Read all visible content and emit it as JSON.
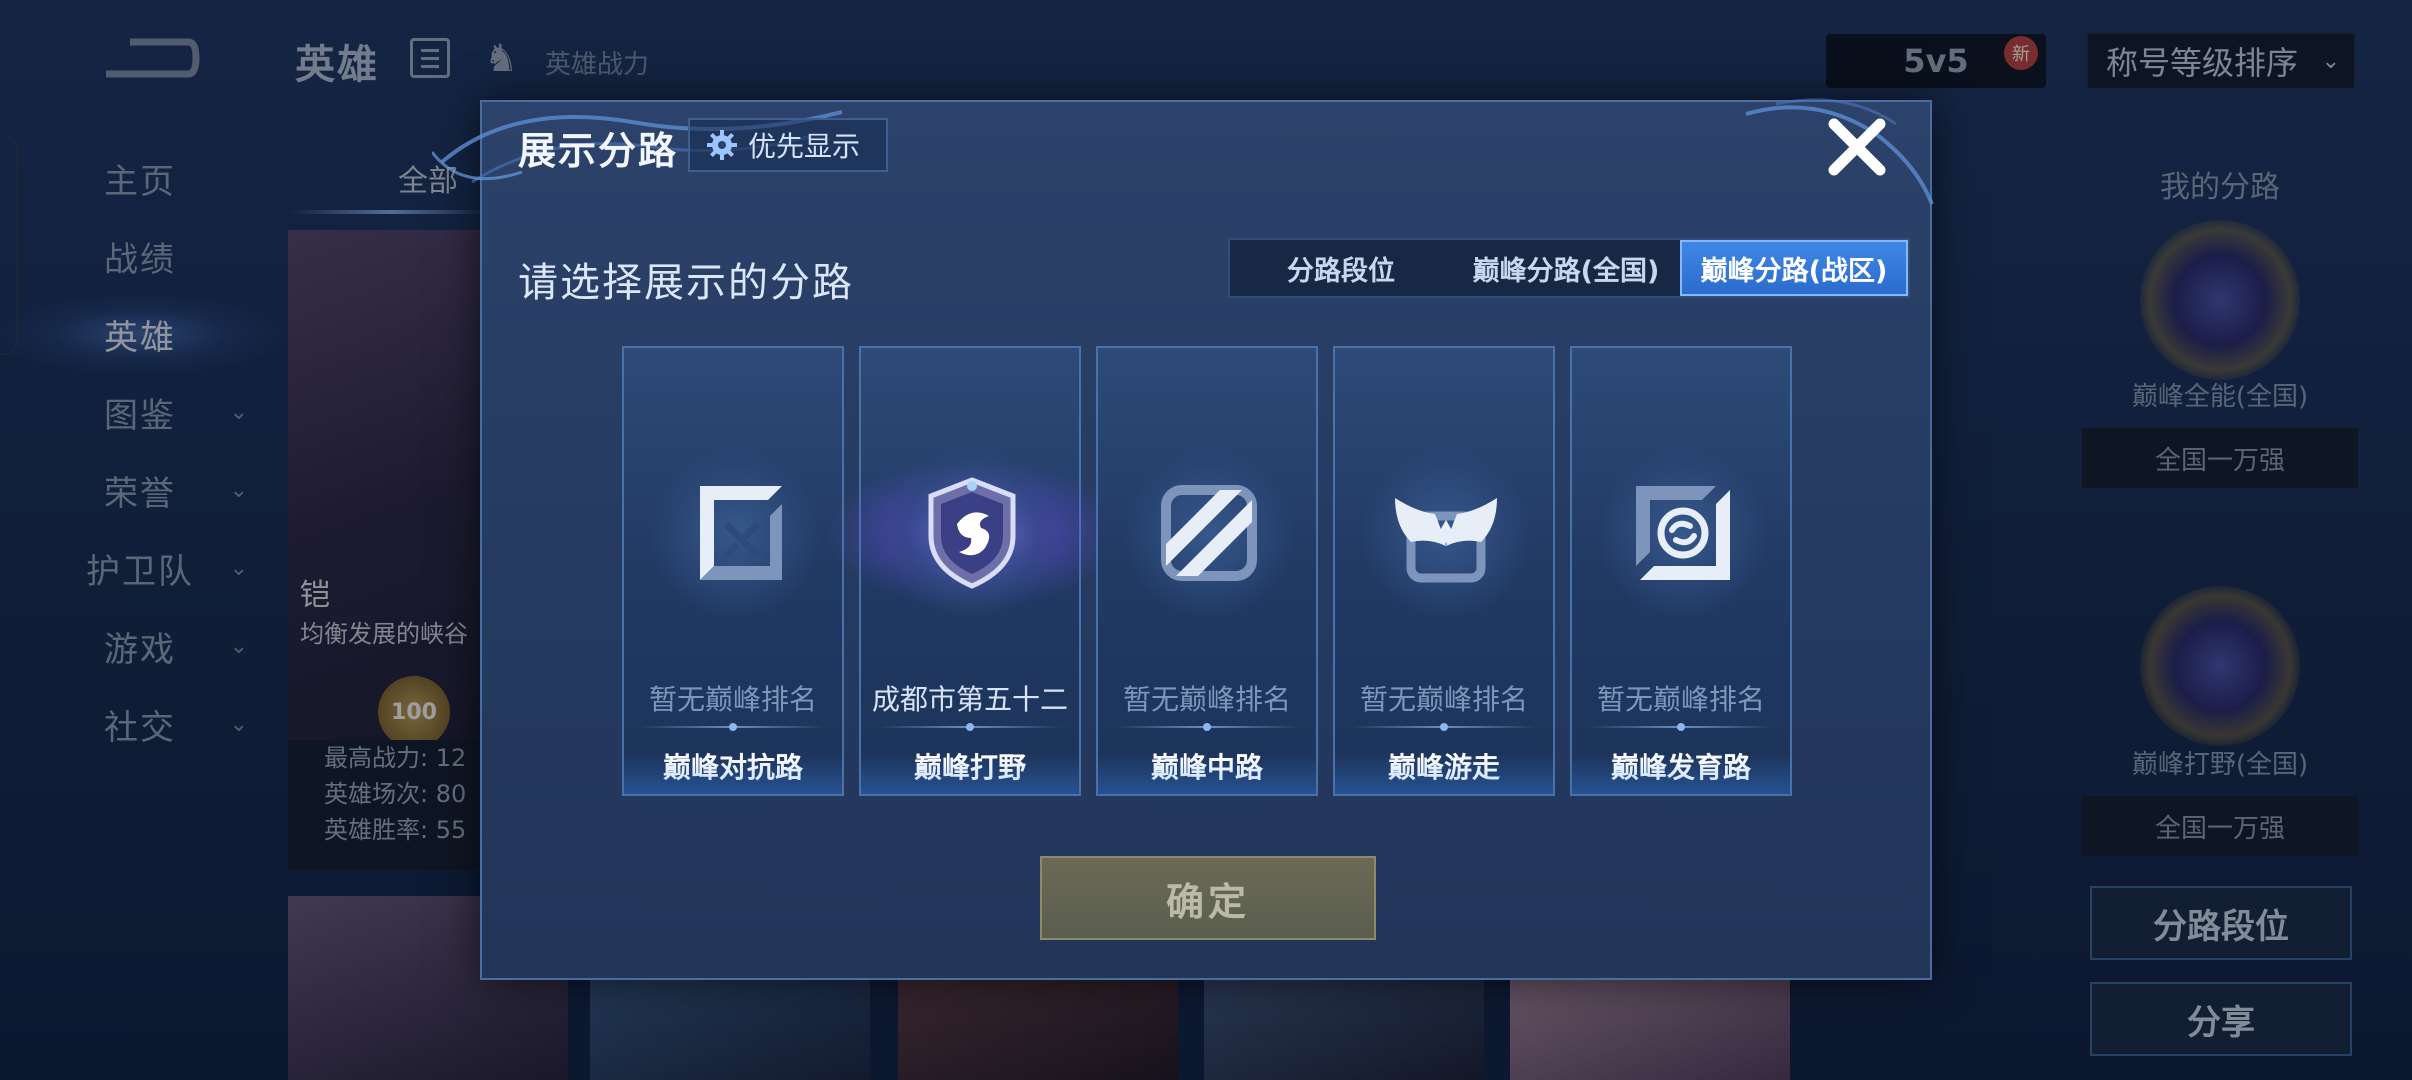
{
  "background": {
    "header": {
      "title": "英雄",
      "power_label": "英雄战力",
      "mode": "5v5",
      "new_badge": "新",
      "sort_label": "称号等级排序"
    },
    "sidebar": {
      "items": [
        {
          "label": "主页",
          "active": false,
          "expandable": false
        },
        {
          "label": "战绩",
          "active": false,
          "expandable": false
        },
        {
          "label": "英雄",
          "active": true,
          "expandable": false
        },
        {
          "label": "图鉴",
          "active": false,
          "expandable": true
        },
        {
          "label": "荣誉",
          "active": false,
          "expandable": true
        },
        {
          "label": "护卫队",
          "active": false,
          "expandable": true
        },
        {
          "label": "游戏",
          "active": false,
          "expandable": true
        },
        {
          "label": "社交",
          "active": false,
          "expandable": true
        }
      ]
    },
    "tabs": {
      "all": "全部"
    },
    "hero_card": {
      "name": "铠",
      "desc": "均衡发展的峡谷",
      "badge": "100",
      "stats": [
        "最高战力: 12",
        "英雄场次: 80",
        "英雄胜率: 55"
      ]
    },
    "right_panel": {
      "title": "我的分路",
      "lanes": [
        {
          "name": "巅峰全能(全国)",
          "rank": "全国一万强"
        },
        {
          "name": "巅峰打野(全国)",
          "rank": "全国一万强"
        }
      ],
      "lane_rank_button": "分路段位",
      "share_button": "分享"
    }
  },
  "modal": {
    "title": "展示分路",
    "priority_button": "优先显示",
    "subtitle": "请选择展示的分路",
    "segments": [
      {
        "label": "分路段位",
        "active": false
      },
      {
        "label": "巅峰分路(全国)",
        "active": false
      },
      {
        "label": "巅峰分路(战区)",
        "active": true
      }
    ],
    "lanes": [
      {
        "name": "巅峰对抗路",
        "rank": "暂无巅峰排名",
        "has_rank": false,
        "icon": "clash-lane-icon"
      },
      {
        "name": "巅峰打野",
        "rank": "成都市第五十二",
        "has_rank": true,
        "icon": "jungle-dragon-emblem"
      },
      {
        "name": "巅峰中路",
        "rank": "暂无巅峰排名",
        "has_rank": false,
        "icon": "mid-lane-icon"
      },
      {
        "name": "巅峰游走",
        "rank": "暂无巅峰排名",
        "has_rank": false,
        "icon": "roam-wings-icon"
      },
      {
        "name": "巅峰发育路",
        "rank": "暂无巅峰排名",
        "has_rank": false,
        "icon": "farm-lane-icon"
      }
    ],
    "confirm_button": "确定"
  },
  "colors": {
    "active_tab": "#3f87e6",
    "modal_bg": "#2c426a",
    "confirm_disabled": "#6a6a56"
  }
}
